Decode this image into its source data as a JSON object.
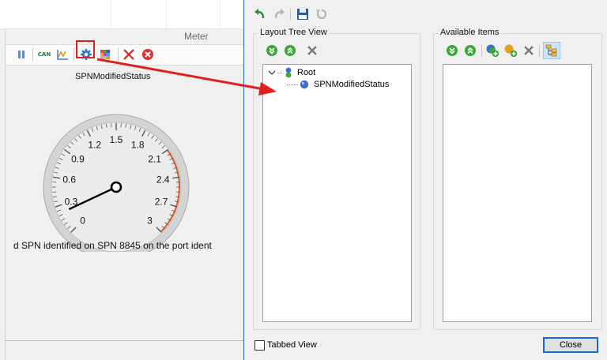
{
  "meter": {
    "title": "Meter",
    "gauge_label": "SPNModifiedStatus",
    "status_text": "d SPN identified on SPN 8845 on the port ident",
    "toolbar": {
      "pause_icon": "pause-icon",
      "can_icon_label": "CAN",
      "settings_icon": "gear-icon",
      "grid_icon": "color-grid-icon",
      "delete_icon": "red-x-icon",
      "close_icon": "red-circle-x-icon"
    }
  },
  "gauge": {
    "ticks": [
      "0",
      "0.3",
      "0.6",
      "0.9",
      "1.2",
      "1.5",
      "1.8",
      "2.1",
      "2.4",
      "2.7",
      "3"
    ],
    "min": 0,
    "max": 3,
    "value": 0.22,
    "warning_color": "#e25b1c",
    "needle_color": "#000000"
  },
  "dialog": {
    "toolbar": {
      "undo_icon": "undo-icon",
      "redo_icon": "redo-icon",
      "save_icon": "save-icon",
      "refresh_icon": "refresh-icon"
    },
    "layout_tree": {
      "title": "Layout Tree View",
      "root_label": "Root",
      "child_label": "SPNModifiedStatus"
    },
    "available_items": {
      "title": "Available Items"
    },
    "tabbed_view_label": "Tabbed View",
    "tabbed_view_checked": false,
    "close_label": "Close"
  },
  "colors": {
    "accent": "#1b6ad0",
    "annotation_red": "#e21f1f",
    "green_button": "#3aa73a"
  }
}
